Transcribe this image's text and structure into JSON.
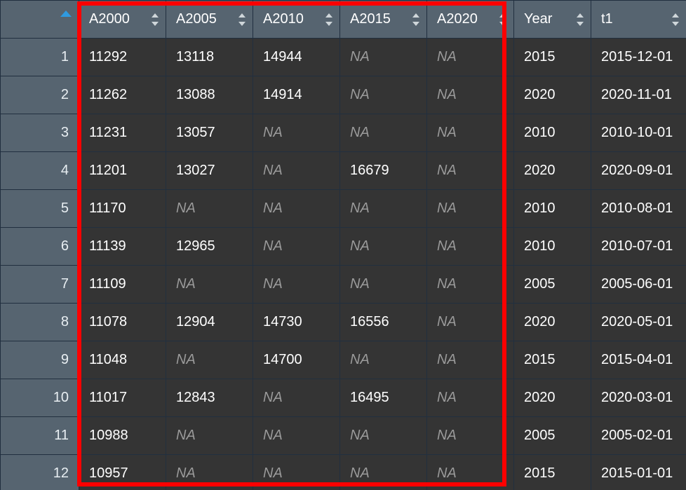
{
  "table": {
    "rownum_header": {
      "label": "",
      "sort_state": "ascending",
      "sort_icon": "triangle-up-icon"
    },
    "columns": [
      {
        "key": "A2000",
        "label": "A2000",
        "sort_icon": "sort-arrows-icon"
      },
      {
        "key": "A2005",
        "label": "A2005",
        "sort_icon": "sort-arrows-icon"
      },
      {
        "key": "A2010",
        "label": "A2010",
        "sort_icon": "sort-arrows-icon"
      },
      {
        "key": "A2015",
        "label": "A2015",
        "sort_icon": "sort-arrows-icon"
      },
      {
        "key": "A2020",
        "label": "A2020",
        "sort_icon": "sort-arrows-icon"
      },
      {
        "key": "Year",
        "label": "Year",
        "sort_icon": "sort-arrows-icon"
      },
      {
        "key": "t1",
        "label": "t1",
        "sort_icon": "sort-arrows-icon"
      }
    ],
    "na_text": "NA",
    "rows": [
      {
        "n": "1",
        "A2000": "11292",
        "A2005": "13118",
        "A2010": "14944",
        "A2015": "NA",
        "A2020": "NA",
        "Year": "2015",
        "t1": "2015-12-01"
      },
      {
        "n": "2",
        "A2000": "11262",
        "A2005": "13088",
        "A2010": "14914",
        "A2015": "NA",
        "A2020": "NA",
        "Year": "2020",
        "t1": "2020-11-01"
      },
      {
        "n": "3",
        "A2000": "11231",
        "A2005": "13057",
        "A2010": "NA",
        "A2015": "NA",
        "A2020": "NA",
        "Year": "2010",
        "t1": "2010-10-01"
      },
      {
        "n": "4",
        "A2000": "11201",
        "A2005": "13027",
        "A2010": "NA",
        "A2015": "16679",
        "A2020": "NA",
        "Year": "2020",
        "t1": "2020-09-01"
      },
      {
        "n": "5",
        "A2000": "11170",
        "A2005": "NA",
        "A2010": "NA",
        "A2015": "NA",
        "A2020": "NA",
        "Year": "2010",
        "t1": "2010-08-01"
      },
      {
        "n": "6",
        "A2000": "11139",
        "A2005": "12965",
        "A2010": "NA",
        "A2015": "NA",
        "A2020": "NA",
        "Year": "2010",
        "t1": "2010-07-01"
      },
      {
        "n": "7",
        "A2000": "11109",
        "A2005": "NA",
        "A2010": "NA",
        "A2015": "NA",
        "A2020": "NA",
        "Year": "2005",
        "t1": "2005-06-01"
      },
      {
        "n": "8",
        "A2000": "11078",
        "A2005": "12904",
        "A2010": "14730",
        "A2015": "16556",
        "A2020": "NA",
        "Year": "2020",
        "t1": "2020-05-01"
      },
      {
        "n": "9",
        "A2000": "11048",
        "A2005": "NA",
        "A2010": "14700",
        "A2015": "NA",
        "A2020": "NA",
        "Year": "2015",
        "t1": "2015-04-01"
      },
      {
        "n": "10",
        "A2000": "11017",
        "A2005": "12843",
        "A2010": "NA",
        "A2015": "16495",
        "A2020": "NA",
        "Year": "2020",
        "t1": "2020-03-01"
      },
      {
        "n": "11",
        "A2000": "10988",
        "A2005": "NA",
        "A2010": "NA",
        "A2015": "NA",
        "A2020": "NA",
        "Year": "2005",
        "t1": "2005-02-01"
      },
      {
        "n": "12",
        "A2000": "10957",
        "A2005": "NA",
        "A2010": "NA",
        "A2015": "NA",
        "A2020": "NA",
        "Year": "2015",
        "t1": "2015-01-01"
      }
    ]
  },
  "annotation": {
    "shape": "rectangle",
    "color": "#fe0000",
    "covers_columns": [
      "A2000",
      "A2005",
      "A2010",
      "A2015",
      "A2020"
    ]
  },
  "colors": {
    "header_background": "#566470",
    "gutter_background": "#566470",
    "cell_background": "#343434",
    "cell_border": "#212f3f",
    "text": "#ffffff",
    "na_text": "#9a9a9a",
    "sort_active": "#2f9ae0",
    "annotation": "#fe0000"
  }
}
